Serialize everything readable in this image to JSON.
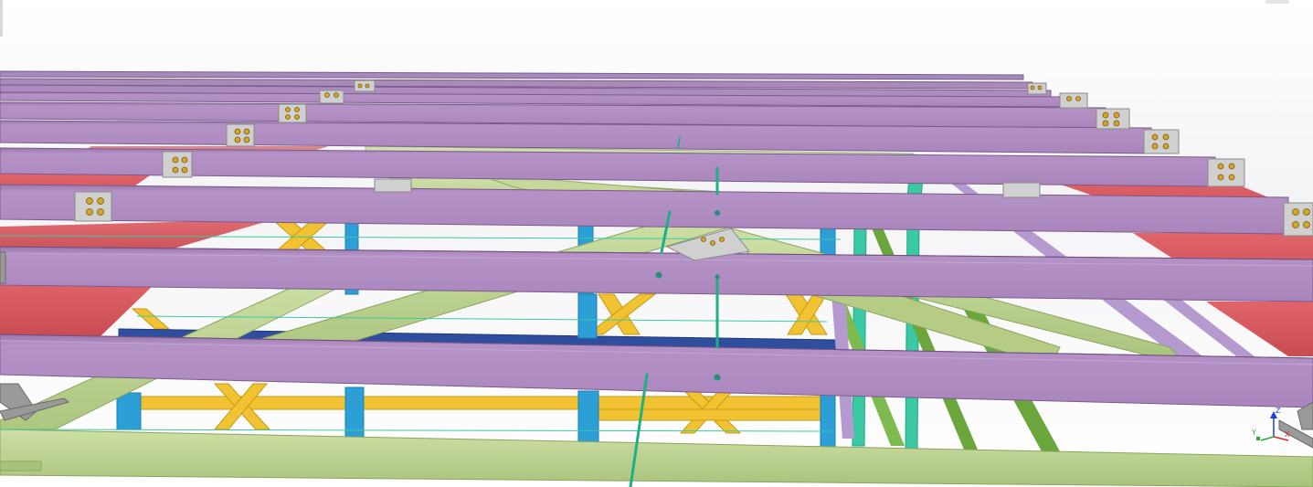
{
  "viewport": {
    "background": "#ffffff",
    "description_colors": {
      "purple_beam": "#b18fc1",
      "purple_beam_shadow": "#8e6ca0",
      "red_plate": "#d9575c",
      "green_brace": "#bcd18f",
      "green_brace_dark": "#6aa63c",
      "yellow_member": "#f1c232",
      "blue_column": "#2b9fd6",
      "navy_beam": "#2f4f9e",
      "teal_column": "#3bc9a4",
      "bolt_plate": "#c8c8c8",
      "bolt": "#d4a52a"
    }
  },
  "axes": {
    "z": "Z",
    "y": "Y",
    "x": "X",
    "z_color": "#1f3fd6",
    "y_color": "#2aa63a",
    "x_color": "#d62828"
  }
}
